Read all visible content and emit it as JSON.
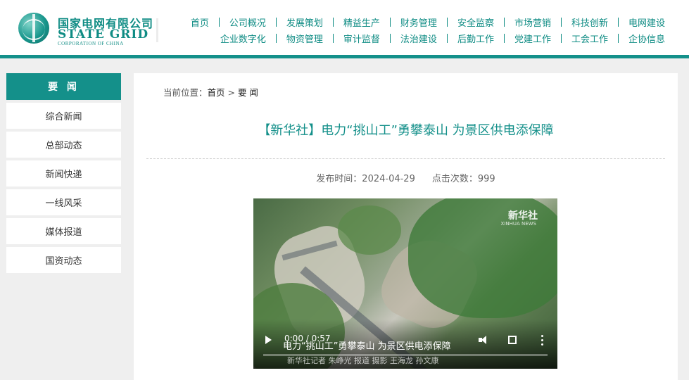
{
  "header": {
    "logo": {
      "cn": "国家电网有限公司",
      "en": "STATE GRID",
      "sub": "CORPORATION OF CHINA"
    },
    "nav_row1": [
      "首页",
      "公司概况",
      "发展策划",
      "精益生产",
      "财务管理",
      "安全监察",
      "市场营销",
      "科技创新",
      "电网建设"
    ],
    "nav_row2": [
      "企业数字化",
      "物资管理",
      "审计监督",
      "法治建设",
      "后勤工作",
      "党建工作",
      "工会工作",
      "企协信息"
    ]
  },
  "sidebar": {
    "heading": "要 闻",
    "items": [
      "综合新闻",
      "总部动态",
      "新闻快递",
      "一线风采",
      "媒体报道",
      "国资动态"
    ]
  },
  "breadcrumb": {
    "prefix": "当前位置：",
    "home": "首页",
    "sep": " > ",
    "current": "要 闻"
  },
  "article": {
    "title": "【新华社】电力“挑山工”勇攀泰山 为景区供电添保障",
    "publish_label": "发布时间：",
    "publish_date": "2024-04-29",
    "clicks_label": "点击次数：",
    "clicks": "999"
  },
  "video": {
    "watermark_cn": "新华社",
    "watermark_en": "XINHUA NEWS",
    "caption": "电力“挑山工”勇攀泰山 为景区供电添保障",
    "subcaption": "新华社记者 朱峥光 报道 摄影 王海龙 孙文康",
    "time": "0:00 / 0:57",
    "progress": 0,
    "icons": [
      "play-icon",
      "volume-icon",
      "fullscreen-icon",
      "more-options-icon"
    ]
  },
  "colors": {
    "accent": "#14908a",
    "text": "#333333"
  }
}
